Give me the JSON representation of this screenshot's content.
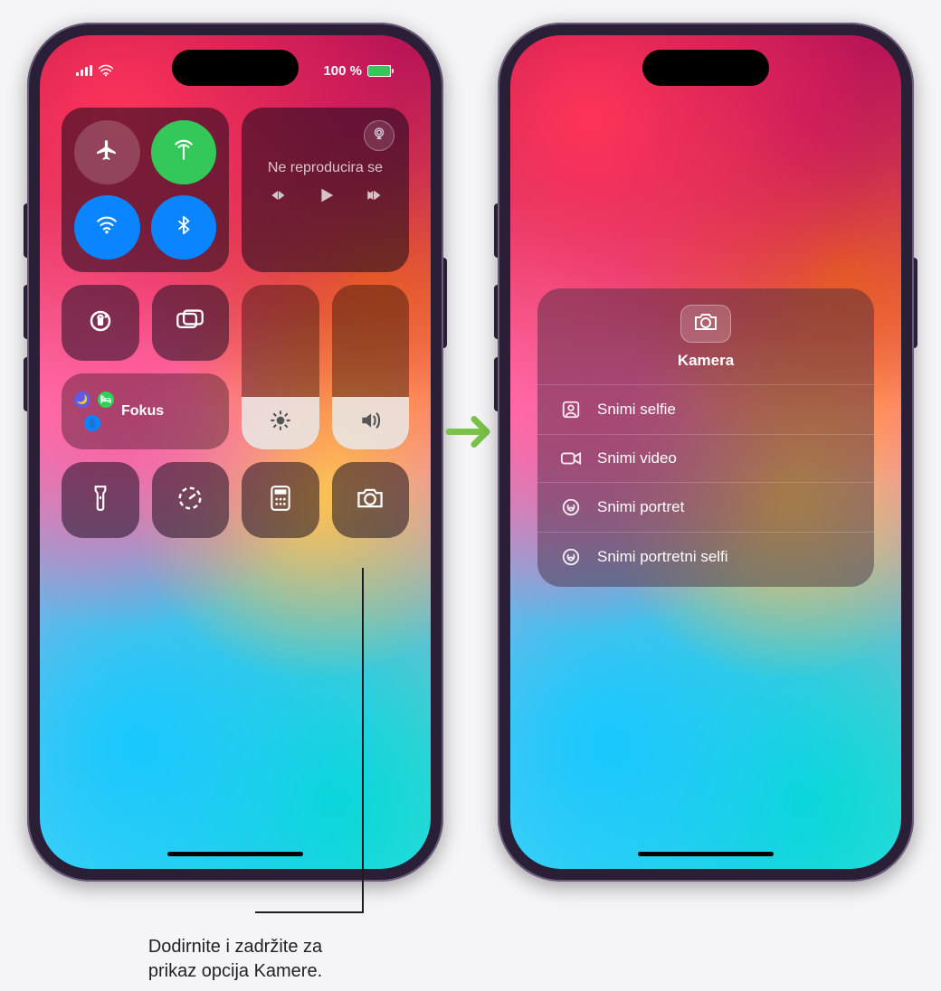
{
  "status": {
    "battery_text": "100 %"
  },
  "control_center": {
    "media": {
      "now_playing_label": "Ne reproducira se"
    },
    "focus": {
      "label": "Fokus"
    }
  },
  "camera_menu": {
    "title": "Kamera",
    "items": [
      {
        "label": "Snimi selfie"
      },
      {
        "label": "Snimi video"
      },
      {
        "label": "Snimi portret"
      },
      {
        "label": "Snimi portretni selfi"
      }
    ]
  },
  "callout": {
    "line1": "Dodirnite i zadržite za",
    "line2": "prikaz opcija Kamere."
  }
}
